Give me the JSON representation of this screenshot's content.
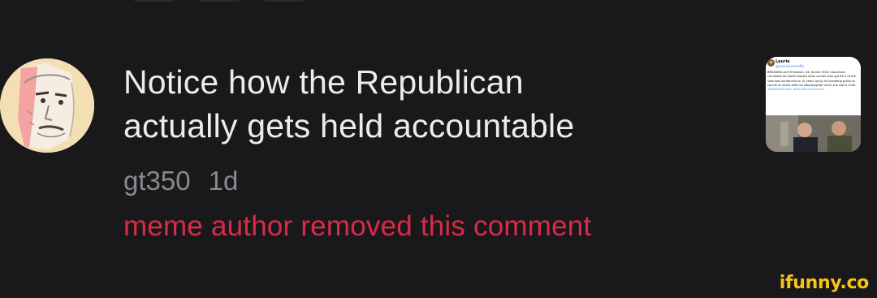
{
  "comment": {
    "text_line1": "Notice how the Republican",
    "text_line2": "actually gets held accountable",
    "username": "gt350",
    "age": "1d",
    "removed_notice": "meme author removed this comment"
  },
  "thumbnail": {
    "tweet_handle": "Laurie",
    "tweet_subhandle": "@LaurieLoveroffy",
    "tweet_body": "BREAKING-Joel M Koskan, 44, former 2022 republican candidate for North Dakota state senate who got 61% of the vote was sentenced to 10 years (only) for pleading guilty to counts of incest with his stepdaughter since she was a child.",
    "tweet_tags": "#NoMAGAQueen #RepublicanGroomer"
  },
  "watermark": {
    "text": "ifunny.co"
  },
  "colors": {
    "background": "#19191b",
    "comment_text": "#ececec",
    "meta_text": "#8a8a8e",
    "removed_text": "#d92b47",
    "watermark": "#f5c518"
  },
  "icons": {
    "avatar": "drawn-face-avatar"
  }
}
